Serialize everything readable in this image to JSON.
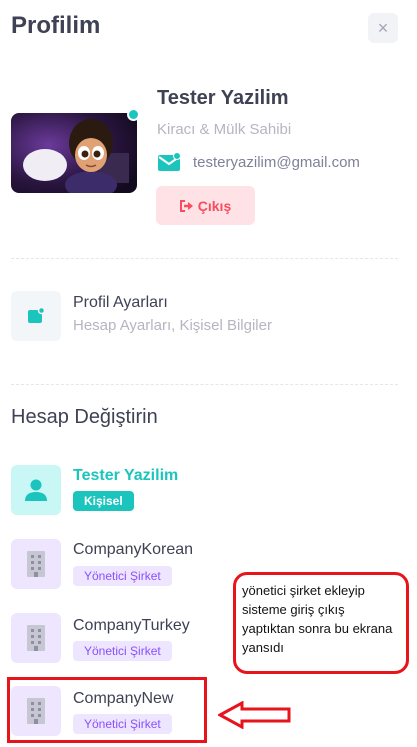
{
  "header": {
    "title": "Profilim",
    "close_label": "×"
  },
  "profile": {
    "name": "Tester Yazilim",
    "role": "Kiracı & Mülk Sahibi",
    "email": "testeryazilim@gmail.com",
    "logout_label": "Çıkış"
  },
  "settings": {
    "title": "Profil Ayarları",
    "subtitle": "Hesap Ayarları, Kişisel Bilgiler"
  },
  "switch_account": {
    "title": "Hesap Değiştirin",
    "accounts": [
      {
        "name": "Tester Yazilim",
        "badge": "Kişisel",
        "icon": "user-icon"
      },
      {
        "name": "CompanyKorean",
        "badge": "Yönetici Şirket",
        "icon": "building-icon"
      },
      {
        "name": "CompanyTurkey",
        "badge": "Yönetici Şirket",
        "icon": "building-icon"
      },
      {
        "name": "CompanyNew",
        "badge": "Yönetici Şirket",
        "icon": "building-icon"
      }
    ]
  },
  "annotation": {
    "note": "yönetici şirket ekleyip sisteme giriş çıkış yaptıktan sonra bu ekrana yansıdı"
  },
  "colors": {
    "accent_teal": "#1bc5bd",
    "danger": "#f64e60",
    "purple": "#8950fc",
    "annotation_red": "#e8141b"
  }
}
